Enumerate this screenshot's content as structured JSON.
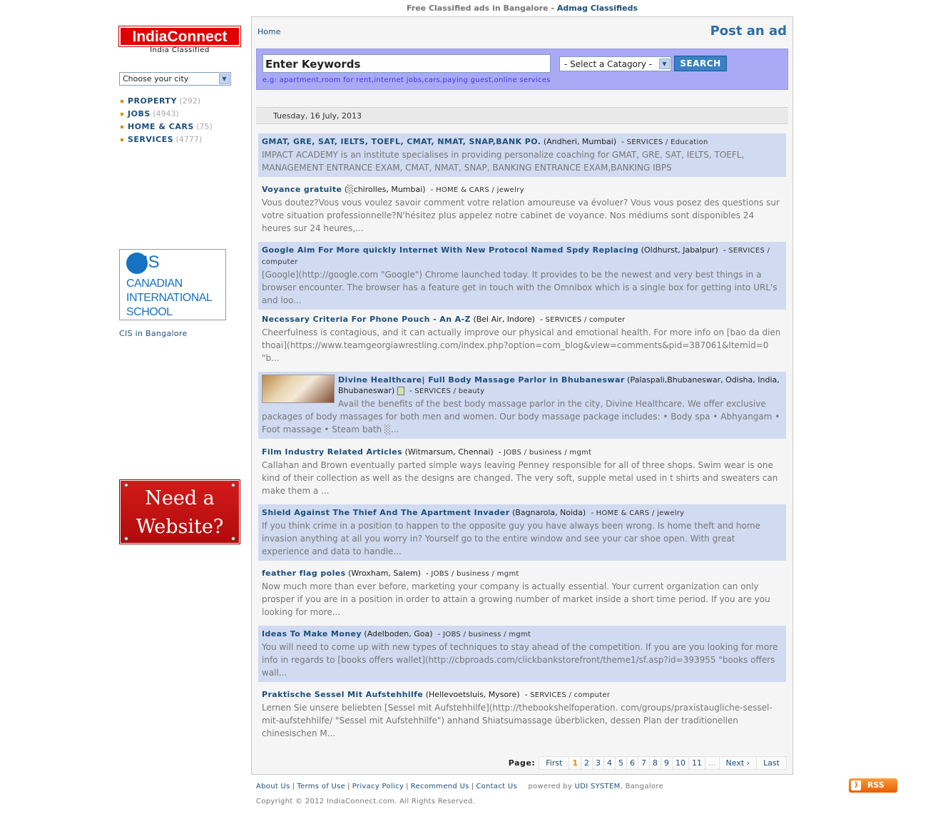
{
  "tagline": {
    "prefix": "Free Classified ads in Bangalore - ",
    "brand": "Admag Classifieds"
  },
  "sidebar": {
    "logo": "IndiaConnect",
    "logo_sub": "India Classified",
    "city_select": "Choose your city",
    "categories": [
      {
        "label": "PROPERTY",
        "count": "(292)"
      },
      {
        "label": "JOBS",
        "count": "(4943)"
      },
      {
        "label": "HOME & CARS",
        "count": "(75)"
      },
      {
        "label": "SERVICES",
        "count": "(4777)"
      }
    ],
    "cis": {
      "abbr": "IS",
      "name_line1": "CANADIAN",
      "name_line2": "INTERNATIONAL",
      "name_line3": "SCHOOL",
      "link": "CIS in Bangalore"
    },
    "need_website": {
      "line1": "Need a",
      "line2": "Website?"
    }
  },
  "header": {
    "home": "Home",
    "post_ad": "Post an ad"
  },
  "search": {
    "keywords_value": "Enter Keywords",
    "category_select": "- Select a Catagory -",
    "button": "SEARCH",
    "hint": "e.g: apartment,room for rent,internet jobs,cars,paying guest,online services"
  },
  "date": "Tuesday, 16 July, 2013",
  "ads": [
    {
      "title": "GMAT, GRE, SAT, IELTS, TOEFL, CMAT, NMAT, SNAP,BANK PO.",
      "location": "(Andheri, Mumbai)",
      "category": "SERVICES / Education",
      "desc": "IMPACT ACADEMY is an institute specialises in providing personalize coaching for GMAT, GRE, SAT, IELTS, TOEFL, MANAGEMENT ENTRANCE EXAM, CMAT, NMAT, SNAP, BANKING ENTRANCE EXAM,BANKING IBPS"
    },
    {
      "title": "Voyance gratuite",
      "location": "(░chirolles, Mumbai)",
      "category": "HOME & CARS / jewelry",
      "desc": "Vous doutez?Vous vous voulez savoir comment votre relation amoureuse va évoluer? Vous vous posez des questions sur votre situation professionnelle?N'hésitez plus appelez notre cabinet de voyance. Nos médiums sont disponibles 24 heures sur 24 heures,..."
    },
    {
      "title": "Google Aim For More quickly Internet With New Protocol Named Spdy Replacing",
      "location": "(Oldhurst, Jabalpur)",
      "category": "SERVICES / computer",
      "desc": "[Google](http://google.com \"Google\") Chrome launched today. It provides to be the newest and very best things in a browser encounter. The browser has a feature get in touch with the Omnibox which is a single box for getting into URL's and loo..."
    },
    {
      "title": "Necessary Criteria For Phone Pouch - An A-Z",
      "location": "(Bel Air, Indore)",
      "category": "SERVICES / computer",
      "desc": "Cheerfulness is contagious, and it can actually improve our physical and emotional health. For more info on [bao da dien thoai](https://www.teamgeorgiawrestling.com/index.php?option=com_blog&view=comments&pid=387061&Itemid=0 \"b..."
    },
    {
      "title": "Divine Healthcare| Full Body Massage Parlor in Bhubaneswar",
      "location": "(Palaspali,Bhubaneswar, Odisha, India, Bhubaneswar)",
      "category": "SERVICES / beauty",
      "desc": "Avail the benefits of the best body massage parlor in the city, Divine Healthcare. We offer exclusive packages of body massages for both men and women. Our body massage package includes: • Body spa • Abhyangam • Foot massage • Steam bath ░..."
    },
    {
      "title": "Film Industry Related Articles",
      "location": "(Witmarsum, Chennai)",
      "category": "JOBS / business / mgmt",
      "desc": "Callahan and Brown eventually parted simple ways leaving Penney responsible for all of three shops. Swim wear is one kind of their collection as well as the designs are changed. The very soft, supple metal used in t shirts and sweaters can make them a ..."
    },
    {
      "title": "Shield Against The Thief And The Apartment Invader",
      "location": "(Bagnarola, Noida)",
      "category": "HOME & CARS / jewelry",
      "desc": "If you think crime in a position to happen to the opposite guy you have always been wrong. Is home theft and home invasion anything at all you worry in? Yourself go to the entire window and see your car shoe open. With great experience and data to handle..."
    },
    {
      "title": "feather flag poles",
      "location": "(Wroxham, Salem)",
      "category": "JOBS / business / mgmt",
      "desc": "Now much more than ever before, marketing your company is actually essential. Your current organization can only prosper if you are in a position in order to attain a growing number of market inside a short time period. If you are you looking for more..."
    },
    {
      "title": "Ideas To Make Money",
      "location": "(Adelboden, Goa)",
      "category": "JOBS / business / mgmt",
      "desc": "You will need to come up with new types of techniques to stay ahead of the competition. If you are you looking for more info in regards to [books offers wallet](http://cbproads.com/clickbankstorefront/theme1/sf.asp?id=393955 \"books offers wall..."
    },
    {
      "title": "Praktische Sessel Mit Aufstehhilfe",
      "location": "(Hellevoetsluis, Mysore)",
      "category": "SERVICES / computer",
      "desc": "Lernen Sie unsere beliebten [Sessel mit Aufstehhilfe](http://thebookshelfoperation. com/groups/praxistaugliche-sessel-mit-aufstehhilfe/ \"Sessel mit Aufstehhilfe\") anhand Shiatsumassage überblicken, dessen Plan der traditionellen chinesischen M..."
    }
  ],
  "pager": {
    "label": "Page:",
    "first": "First",
    "pages": [
      "1",
      "2",
      "3",
      "4",
      "5",
      "6",
      "7",
      "8",
      "9",
      "10",
      "11"
    ],
    "current": "1",
    "ellipsis": "...",
    "next": "Next ›",
    "last": "Last"
  },
  "footer": {
    "links": [
      "About Us",
      "Terms of Use",
      "Privacy Policy",
      "Recommend Us",
      "Contact Us"
    ],
    "powered_prefix": "powered by ",
    "powered_brand": "UDI SYSTEM",
    "powered_suffix": ", Bangalore",
    "copyright": "Copyright © 2012 IndiaConnect.com. All Rights Reserved.",
    "rss": "RSS"
  }
}
